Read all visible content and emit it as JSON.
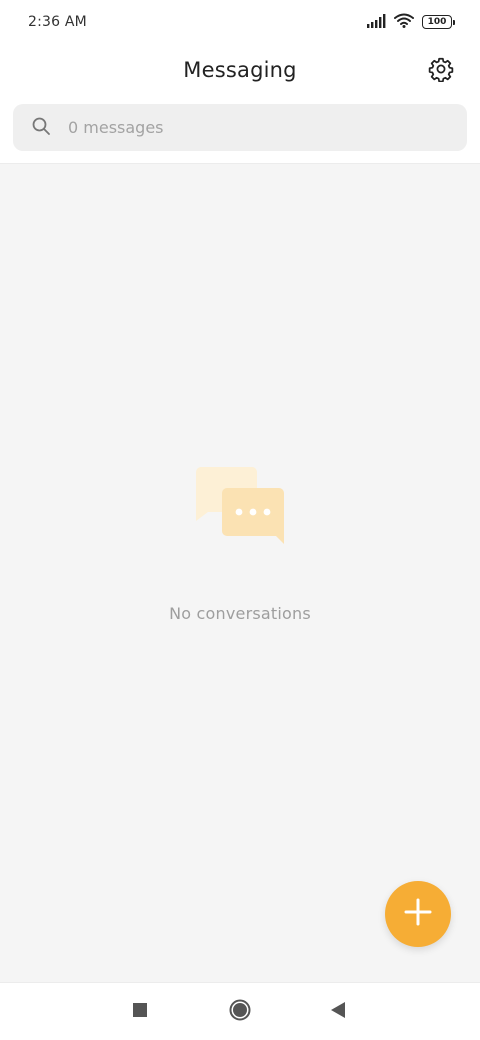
{
  "status_bar": {
    "time": "2:36 AM",
    "battery": "100",
    "icons": [
      "signal-icon",
      "wifi-icon",
      "battery-icon"
    ]
  },
  "header": {
    "title": "Messaging",
    "settings_icon": "gear-icon"
  },
  "search": {
    "placeholder": "0 messages",
    "value": "",
    "icon": "search-icon"
  },
  "empty_state": {
    "icon": "chat-bubbles-icon",
    "text": "No conversations"
  },
  "fab": {
    "icon": "plus-icon",
    "color": "#f6ad35"
  },
  "nav_bar": {
    "buttons": [
      "recents-icon",
      "home-icon",
      "back-icon"
    ]
  },
  "colors": {
    "accent": "#f6ad35",
    "background": "#f5f5f5",
    "search_bg": "#efefef"
  }
}
